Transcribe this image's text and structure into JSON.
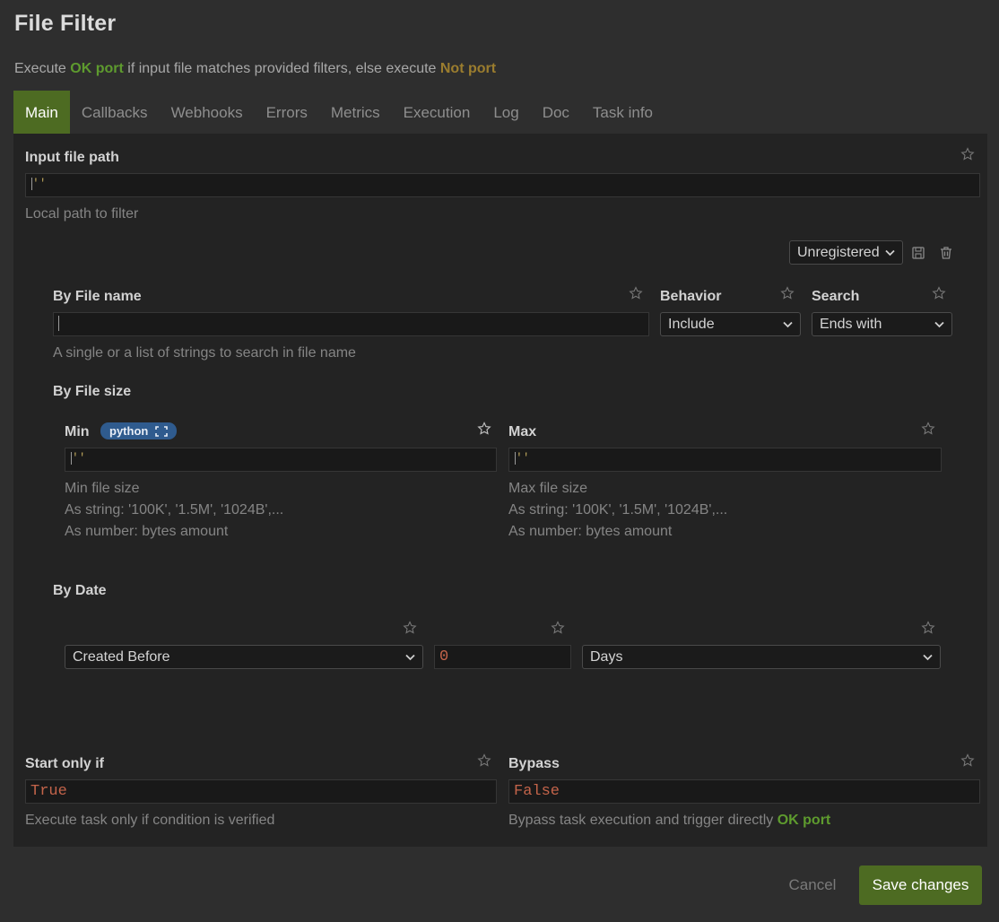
{
  "dialog": {
    "title": "File Filter",
    "description": {
      "prefix": "Execute ",
      "ok_port": "OK port",
      "middle": " if input file matches provided filters, else execute ",
      "not_port": "Not port"
    }
  },
  "tabs": [
    {
      "label": "Main",
      "active": true
    },
    {
      "label": "Callbacks"
    },
    {
      "label": "Webhooks"
    },
    {
      "label": "Errors"
    },
    {
      "label": "Metrics"
    },
    {
      "label": "Execution"
    },
    {
      "label": "Log"
    },
    {
      "label": "Doc"
    },
    {
      "label": "Task info"
    }
  ],
  "input_file_path": {
    "label": "Input file path",
    "value": "''",
    "help": "Local path to filter"
  },
  "registration": {
    "selected": "Unregistered",
    "save_icon": "floppy-disk-icon",
    "delete_icon": "trash-icon"
  },
  "by_file_name": {
    "label": "By File name",
    "value": "",
    "help": "A single or a list of strings to search in file name"
  },
  "behavior": {
    "label": "Behavior",
    "selected": "Include"
  },
  "search": {
    "label": "Search",
    "selected": "Ends with"
  },
  "by_file_size": {
    "label": "By File size",
    "min": {
      "label": "Min",
      "badge": "python",
      "value": "''",
      "help": [
        "Min file size",
        "As string: '100K', '1.5M', '1024B',...",
        "As number: bytes amount"
      ]
    },
    "max": {
      "label": "Max",
      "value": "''",
      "help": [
        "Max file size",
        "As string: '100K', '1.5M', '1024B',...",
        "As number: bytes amount"
      ]
    }
  },
  "by_date": {
    "label": "By Date",
    "condition": "Created Before",
    "amount": "0",
    "unit": "Days"
  },
  "start_only_if": {
    "label": "Start only if",
    "value": "True",
    "help": "Execute task only if condition is verified"
  },
  "bypass": {
    "label": "Bypass",
    "value": "False",
    "help_prefix": "Bypass task execution and trigger directly ",
    "help_port": "OK port"
  },
  "footer": {
    "cancel": "Cancel",
    "save": "Save changes"
  },
  "colors": {
    "accent_green": "#4d6b22",
    "ok_port": "#5e9b2e",
    "not_port": "#9b7d2e",
    "badge_blue": "#2f5b8e",
    "code_value": "#c4644a"
  }
}
